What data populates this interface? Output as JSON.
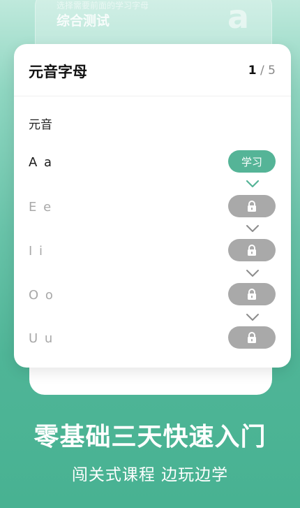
{
  "background_card": {
    "faint_text": "选择需要前面的学习字母",
    "title": "综合测试",
    "letter": "a"
  },
  "card": {
    "title": "元音字母",
    "page_current": "1",
    "page_separator": "/",
    "page_total": "5",
    "section": "元音",
    "rows": [
      {
        "letters": "A a",
        "state": "learn",
        "button_label": "学习"
      },
      {
        "letters": "E e",
        "state": "locked"
      },
      {
        "letters": "I i",
        "state": "locked"
      },
      {
        "letters": "O o",
        "state": "locked"
      },
      {
        "letters": "U u",
        "state": "locked"
      }
    ]
  },
  "promo": {
    "headline": "零基础三天快速入门",
    "subline": "闯关式课程 边玩边学"
  },
  "colors": {
    "accent": "#55b497",
    "locked": "#a9a9a9",
    "active_chevron": "#55b497",
    "locked_chevron": "#8c8c8c"
  },
  "icons": {
    "lock": "lock-icon",
    "chevron": "chevron-down-icon"
  }
}
